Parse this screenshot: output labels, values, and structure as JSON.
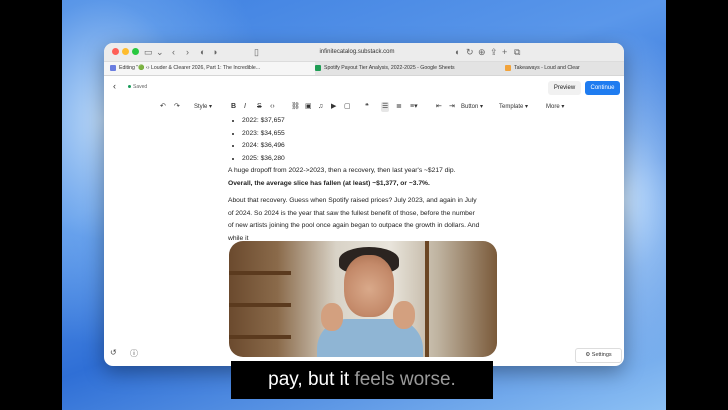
{
  "browser": {
    "url": "infinitecatalog.substack.com",
    "tabs": [
      {
        "label": "Editing \"🟢 ‹› Louder & Clearer 2026, Part 1: The Incredible...",
        "active": true
      },
      {
        "label": "Spotify Payout Tier Analysis, 2022-2025 - Google Sheets",
        "active": false
      },
      {
        "label": "Takeaways - Loud and Clear",
        "active": false
      }
    ]
  },
  "editor": {
    "saved_label": "Saved",
    "preview_label": "Preview",
    "continue_label": "Continue",
    "settings_label": "Settings"
  },
  "toolbar": {
    "style_label": "Style",
    "button_label": "Button",
    "template_label": "Template",
    "more_label": "More"
  },
  "document": {
    "bullets": [
      "2022: $37,657",
      "2023: $34,655",
      "2024: $36,496",
      "2025: $36,280"
    ],
    "para1": "A huge dropoff from 2022->2023, then a recovery, then last year's ~$217 dip.",
    "para1_bold": "Overall, the average slice has fallen (at least) ~$1,377, or ~3.7%.",
    "para2_lines": [
      "About that recovery. Guess when Spotify raised prices? July 2023, and again in July",
      "of 2024. So 2024 is the year that saw the fullest benefit of those, before the number",
      "of new artists joining the pool once again began to outpace the growth in dollars. And",
      "while it"
    ]
  },
  "caption": {
    "bright": "pay, but it ",
    "dim": "feels worse."
  },
  "colors": {
    "accent": "#1f7cf0",
    "saved_dot": "#1a9b5a"
  }
}
